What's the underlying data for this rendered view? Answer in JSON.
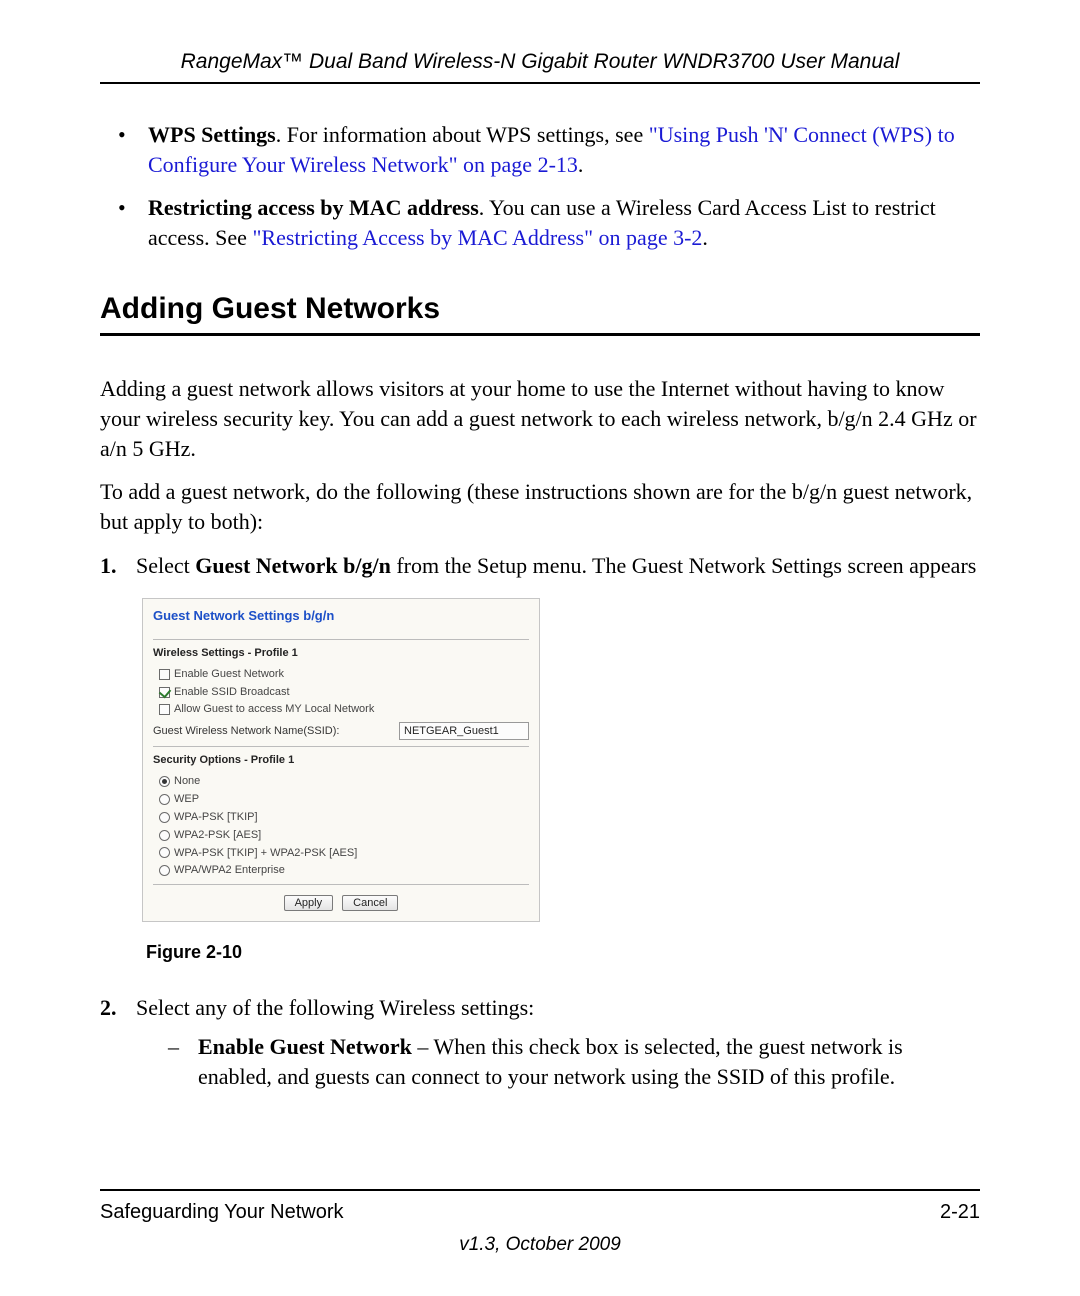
{
  "header": {
    "title": "RangeMax™ Dual Band Wireless-N Gigabit Router WNDR3700 User Manual"
  },
  "bullets": {
    "wps": {
      "label": "WPS Settings",
      "text_after_label": ". For information about WPS settings, see ",
      "link": "\"Using Push 'N' Connect (WPS) to Configure Your Wireless Network\" on page 2-13",
      "after_link": "."
    },
    "mac": {
      "label": "Restricting access by MAC address",
      "text_after_label": ". You can use a Wireless Card Access List to restrict access. See ",
      "link": "\"Restricting Access by MAC Address\" on page 3-2",
      "after_link": "."
    }
  },
  "section": {
    "heading": "Adding Guest Networks",
    "para1": "Adding a guest network allows visitors at your home to use the Internet without having to know your wireless security key. You can add a guest network to each wireless network, b/g/n 2.4 GHz or a/n 5 GHz.",
    "para2": "To add a guest network, do the following (these instructions shown are for the b/g/n guest network, but apply to both):"
  },
  "steps": {
    "s1": {
      "num": "1.",
      "pre": "Select ",
      "bold": "Guest Network b/g/n",
      "post": " from the Setup menu. The Guest Network Settings screen appears"
    },
    "s2": {
      "num": "2.",
      "text": "Select any of the following Wireless settings:",
      "dash1_bold": "Enable Guest Network",
      "dash1_text": " – When this check box is selected, the guest network is enabled, and guests can connect to your network using the SSID of this profile."
    }
  },
  "figure": {
    "panel_title": "Guest Network Settings b/g/n",
    "wireless_head": "Wireless Settings - Profile 1",
    "cb1": "Enable Guest Network",
    "cb2": "Enable SSID Broadcast",
    "cb3": "Allow Guest to access MY Local Network",
    "ssid_label": "Guest Wireless Network Name(SSID):",
    "ssid_value": "NETGEAR_Guest1",
    "security_head": "Security Options - Profile 1",
    "opt_none": "None",
    "opt_wep": "WEP",
    "opt_wpa_tkip": "WPA-PSK [TKIP]",
    "opt_wpa2_aes": "WPA2-PSK [AES]",
    "opt_wpa_mix": "WPA-PSK [TKIP] + WPA2-PSK [AES]",
    "opt_enterprise": "WPA/WPA2 Enterprise",
    "btn_apply": "Apply",
    "btn_cancel": "Cancel",
    "caption": "Figure 2-10"
  },
  "footer": {
    "left": "Safeguarding Your Network",
    "right": "2-21",
    "version": "v1.3, October 2009"
  }
}
